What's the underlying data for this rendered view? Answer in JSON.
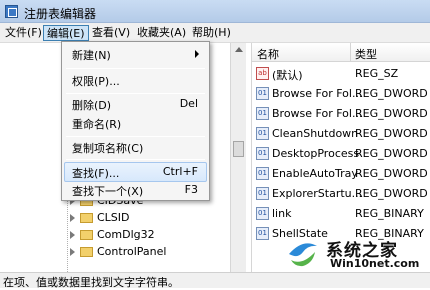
{
  "window": {
    "title": "注册表编辑器"
  },
  "menubar": {
    "items": [
      {
        "label": "文件(F)"
      },
      {
        "label": "编辑(E)"
      },
      {
        "label": "查看(V)"
      },
      {
        "label": "收藏夹(A)"
      },
      {
        "label": "帮助(H)"
      }
    ]
  },
  "context_menu": {
    "items": [
      {
        "label": "新建(N)",
        "shortcut": "",
        "submenu": true
      },
      {
        "label": "权限(P)...",
        "shortcut": ""
      },
      {
        "label": "删除(D)",
        "shortcut": "Del"
      },
      {
        "label": "重命名(R)",
        "shortcut": ""
      },
      {
        "label": "复制项名称(C)",
        "shortcut": ""
      },
      {
        "label": "查找(F)...",
        "shortcut": "Ctrl+F"
      },
      {
        "label": "查找下一个(X)",
        "shortcut": "F3"
      }
    ]
  },
  "tree": {
    "cut_text": "ns",
    "nodes": [
      {
        "label": "CIDSave"
      },
      {
        "label": "CLSID"
      },
      {
        "label": "ComDlg32"
      },
      {
        "label": "ControlPanel"
      }
    ]
  },
  "list": {
    "header": {
      "name": "名称",
      "type": "类型"
    },
    "rows": [
      {
        "name": "(默认)",
        "type": "REG_SZ",
        "icon": "string-value-icon"
      },
      {
        "name": "Browse For Fol...",
        "type": "REG_DWORD",
        "icon": "binary-value-icon"
      },
      {
        "name": "Browse For Fol...",
        "type": "REG_DWORD",
        "icon": "binary-value-icon"
      },
      {
        "name": "CleanShutdown",
        "type": "REG_DWORD",
        "icon": "binary-value-icon"
      },
      {
        "name": "DesktopProcess",
        "type": "REG_DWORD",
        "icon": "binary-value-icon"
      },
      {
        "name": "EnableAutoTray",
        "type": "REG_DWORD",
        "icon": "binary-value-icon"
      },
      {
        "name": "ExplorerStartu...",
        "type": "REG_DWORD",
        "icon": "binary-value-icon"
      },
      {
        "name": "link",
        "type": "REG_BINARY",
        "icon": "binary-value-icon"
      },
      {
        "name": "ShellState",
        "type": "REG_BINARY",
        "icon": "binary-value-icon"
      }
    ]
  },
  "status": {
    "text": "在项、值或数据里找到文字字符串。"
  },
  "watermark": {
    "line1": "系统之家",
    "line2": "Win10net.com"
  },
  "colors": {
    "accent": "#3c7fb1",
    "highlight": "#d7e8fb"
  }
}
